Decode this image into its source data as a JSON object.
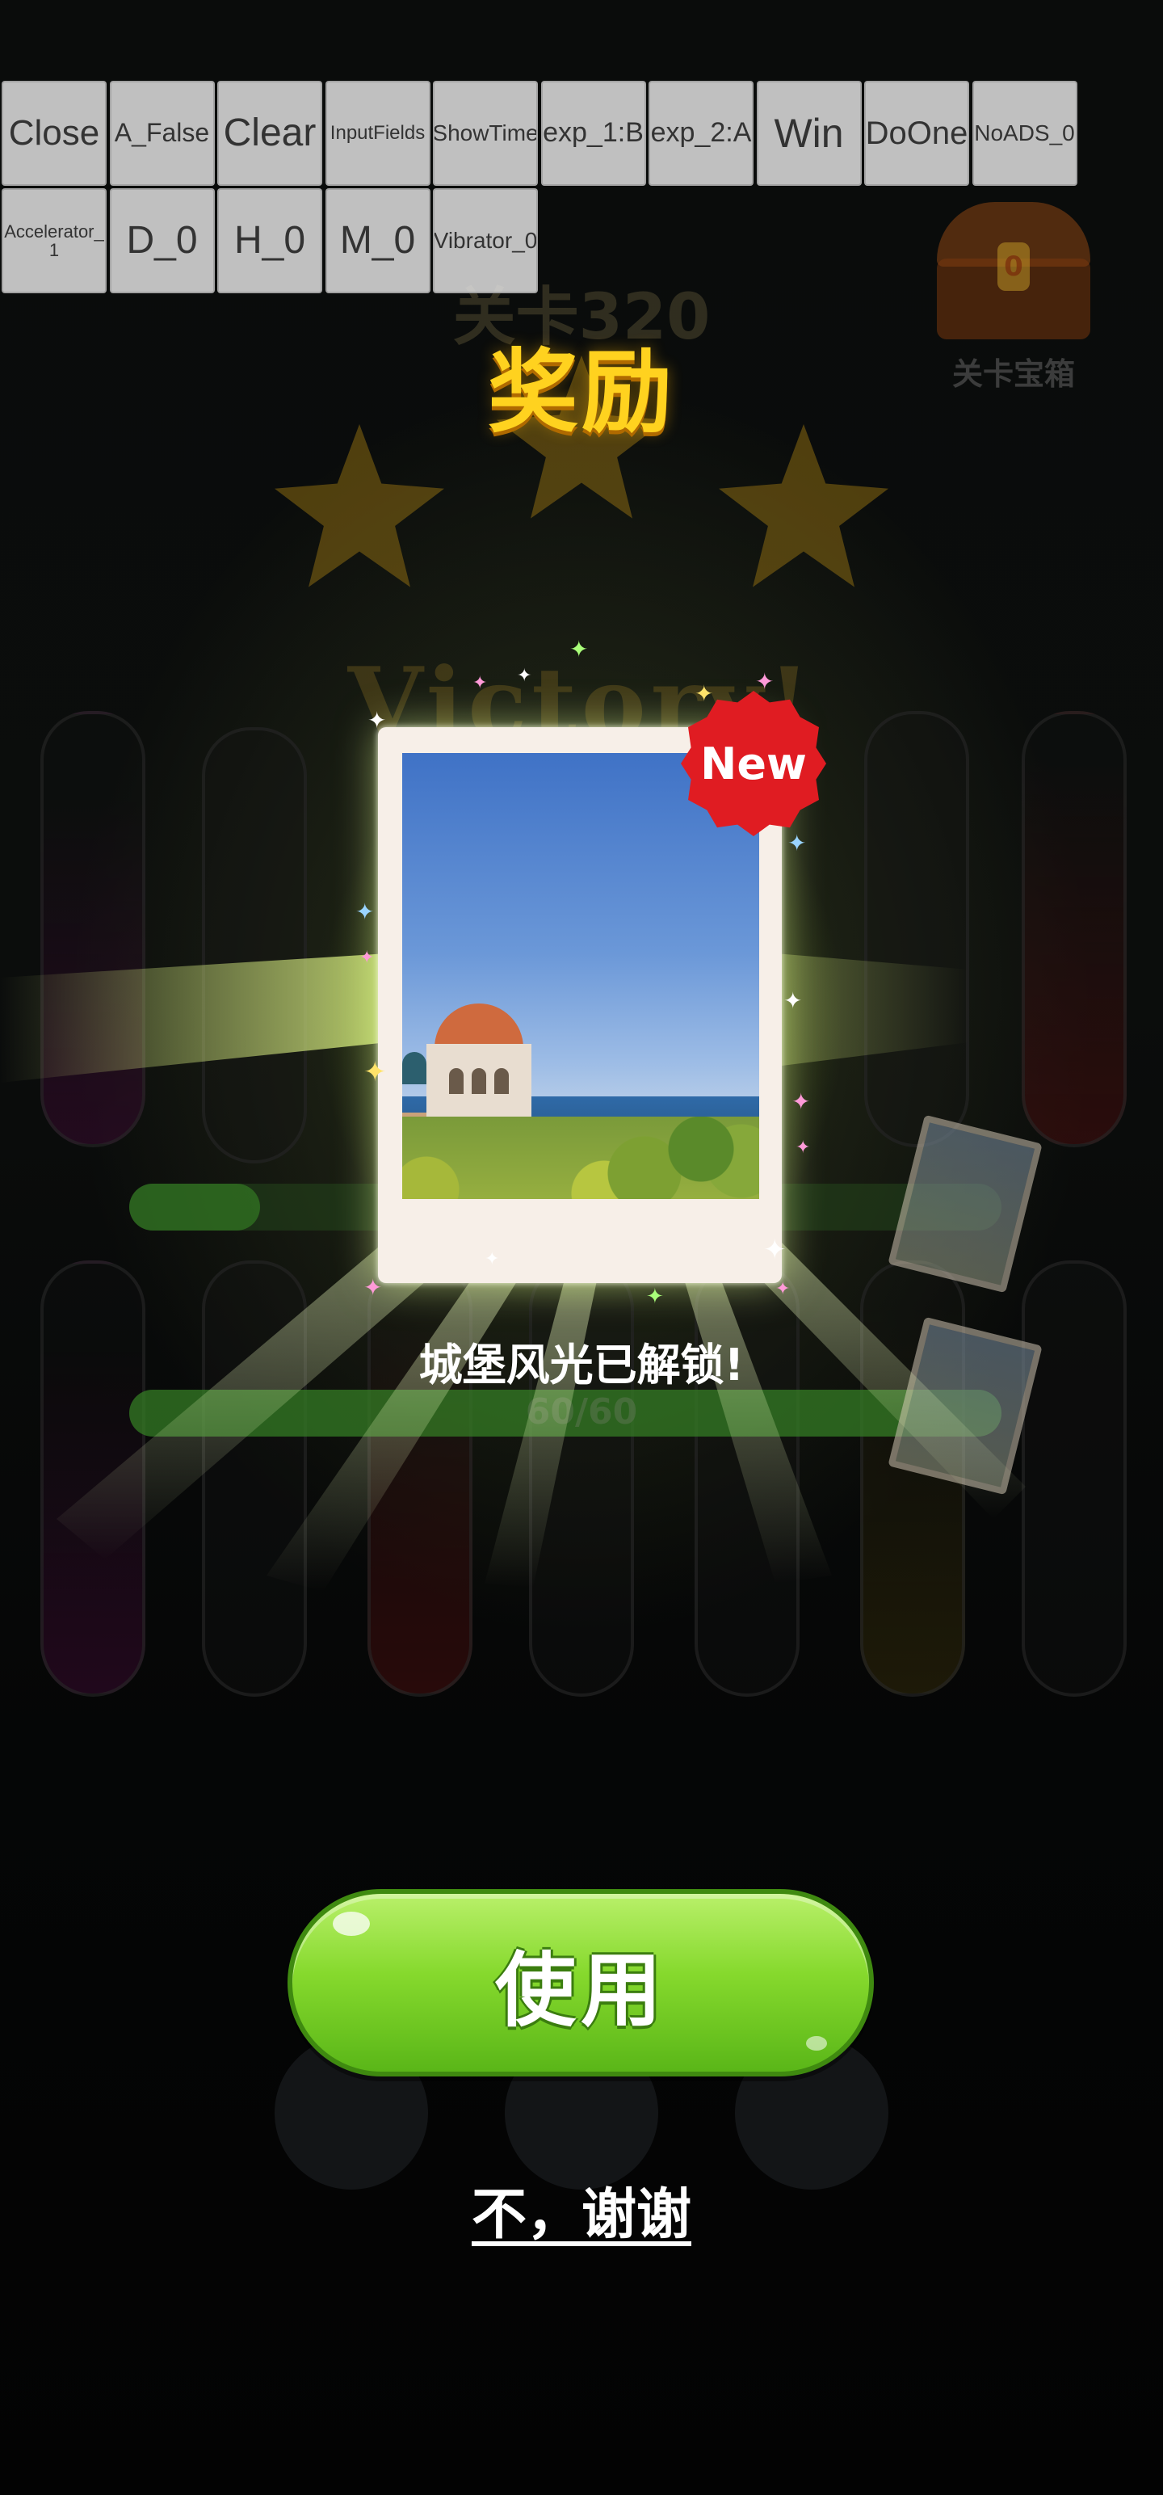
{
  "debug_buttons": [
    {
      "label": "Close",
      "font": 44
    },
    {
      "label": "A_False",
      "font": 32
    },
    {
      "label": "Clear",
      "font": 48
    },
    {
      "label": "InputFields",
      "font": 24
    },
    {
      "label": "ShowTime",
      "font": 28
    },
    {
      "label": "exp_1:B",
      "font": 34
    },
    {
      "label": "exp_2:A",
      "font": 34
    },
    {
      "label": "Win",
      "font": 50
    },
    {
      "label": "DoOne",
      "font": 40
    },
    {
      "label": "NoADS_0",
      "font": 28
    },
    {
      "label": "Accelerator_\n1",
      "font": 22
    },
    {
      "label": "D_0",
      "font": 48
    },
    {
      "label": "H_0",
      "font": 48
    },
    {
      "label": "M_0",
      "font": 48
    },
    {
      "label": "Vibrator_0",
      "font": 28
    }
  ],
  "background": {
    "level_title": "关卡320",
    "victory_text": "Victory!",
    "chest_label": "关卡宝箱",
    "chest_lock_number": "0",
    "progress_text": "60/60",
    "progress_fraction": 1.0
  },
  "reward": {
    "title": "奖励",
    "badge": "New",
    "unlock_message": "城堡风光已解锁!",
    "use_button_label": "使用",
    "decline_label": "不，谢谢"
  },
  "colors": {
    "title_gold": "#ffd21f",
    "button_green": "#86d92d",
    "badge_red": "#e01c22"
  }
}
